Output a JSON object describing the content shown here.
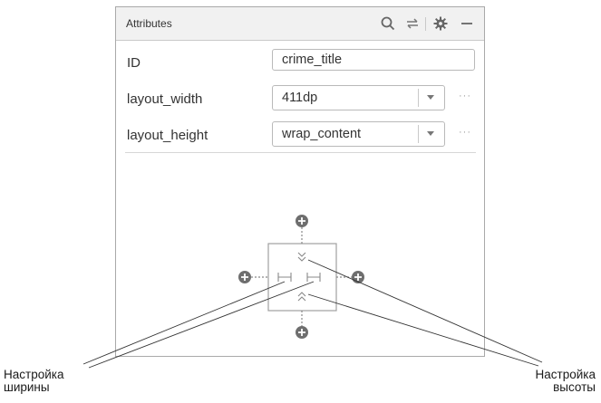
{
  "panel": {
    "title": "Attributes",
    "header_icons": [
      "search-icon",
      "swap-icon",
      "gear-icon",
      "minimize-icon"
    ]
  },
  "attributes": {
    "id": {
      "label": "ID",
      "value": "crime_title"
    },
    "layout_width": {
      "label": "layout_width",
      "value": "411dp",
      "more": "···"
    },
    "layout_height": {
      "label": "layout_height",
      "value": "wrap_content",
      "more": "···"
    }
  },
  "callouts": {
    "width": {
      "line1": "Настройка",
      "line2": "ширины"
    },
    "height": {
      "line1": "Настройка",
      "line2": "высоты"
    }
  },
  "colors": {
    "header_bg": "#f1f1f1",
    "border": "#a9a9a9",
    "icon_gray": "#777777"
  }
}
